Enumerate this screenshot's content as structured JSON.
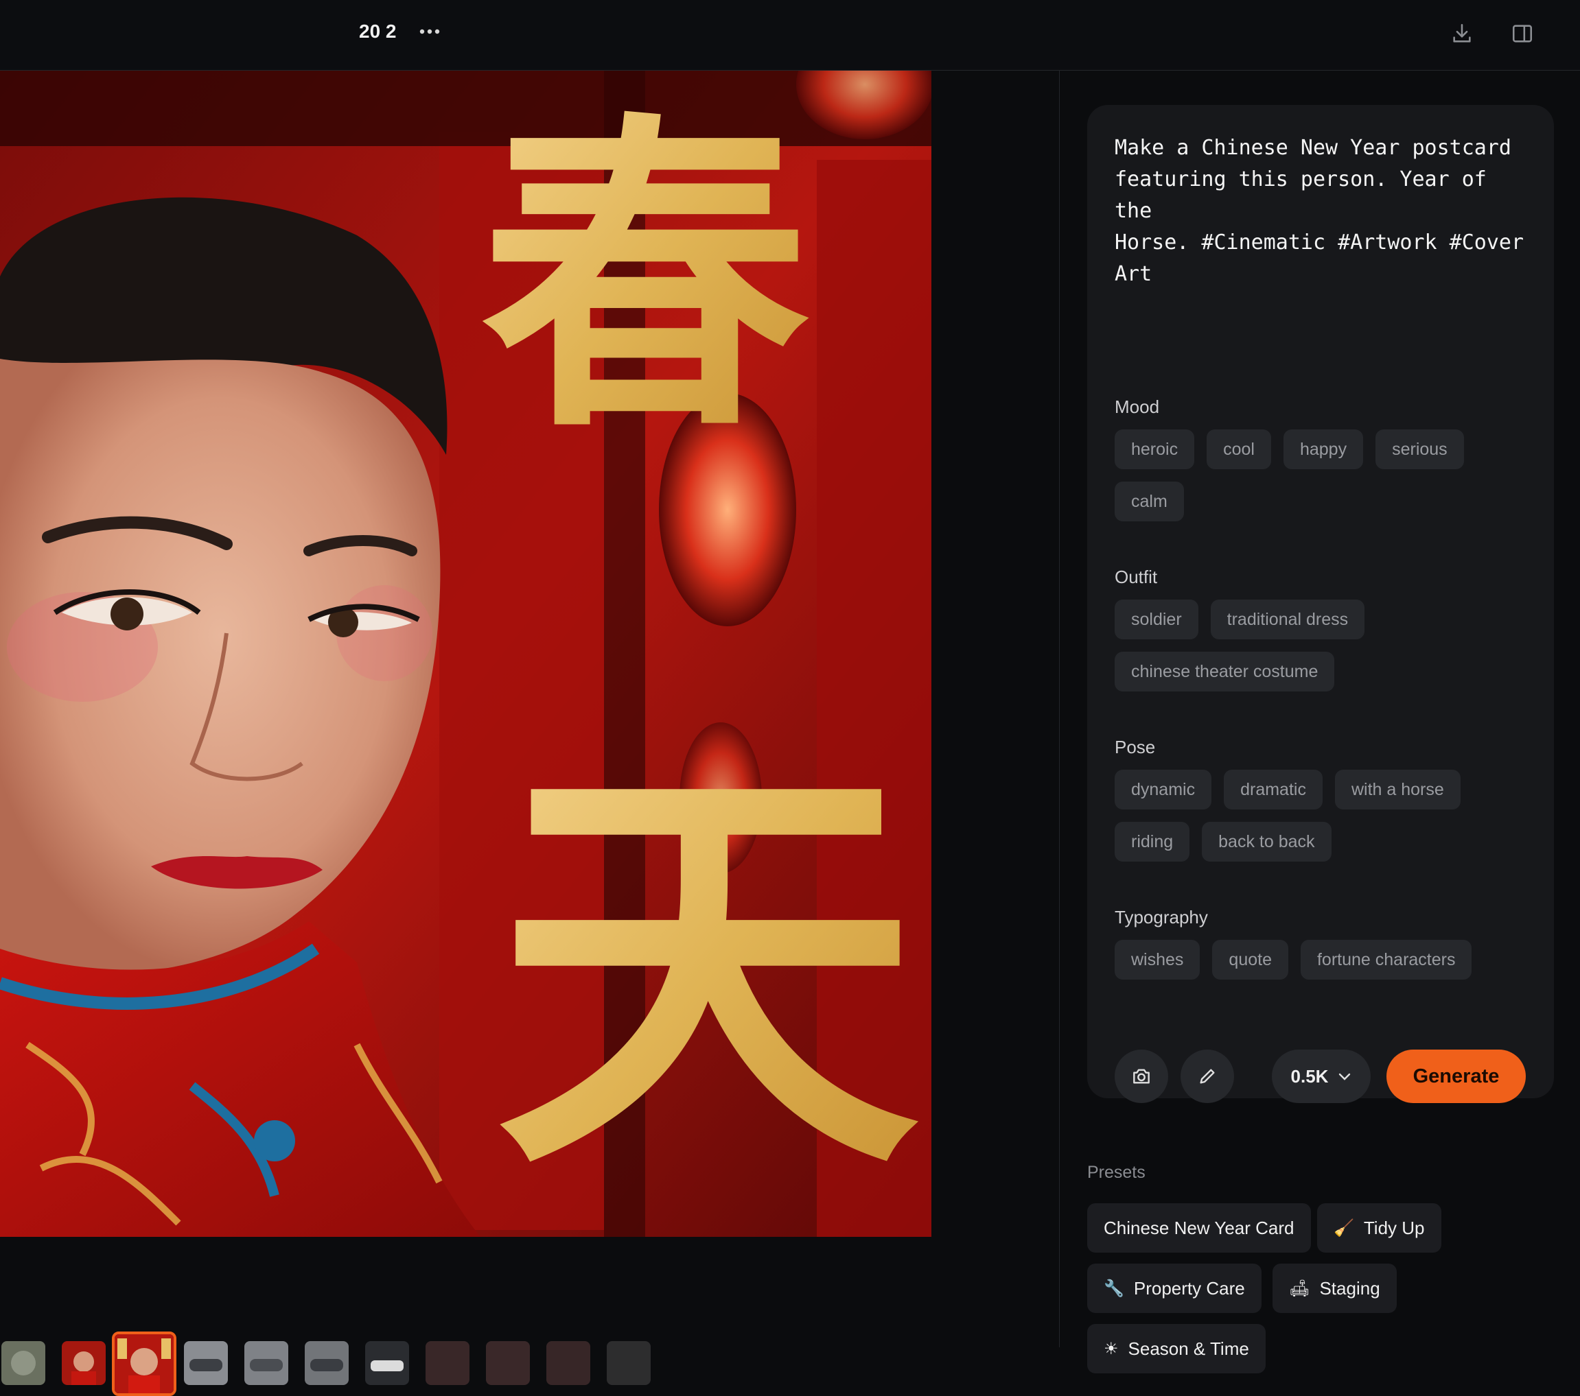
{
  "topbar": {
    "counter": "20 2",
    "more_icon": "more-horizontal-icon",
    "download_icon": "download-icon",
    "panel_icon": "sidebar-panel-icon"
  },
  "viewer": {
    "overlay_characters": [
      "春",
      "天"
    ],
    "filmstrip_count": 11,
    "selected_thumbnail_index": 2
  },
  "prompt": {
    "text": "Make a Chinese New Year postcard\nfeaturing this person. Year of the\nHorse. #Cinematic #Artwork #Cover\nArt"
  },
  "groups": [
    {
      "label": "Mood",
      "rows": [
        [
          "heroic",
          "cool",
          "happy",
          "serious"
        ],
        [
          "calm"
        ]
      ]
    },
    {
      "label": "Outfit",
      "rows": [
        [
          "soldier",
          "traditional dress"
        ],
        [
          "chinese theater costume"
        ]
      ]
    },
    {
      "label": "Pose",
      "rows": [
        [
          "dynamic",
          "dramatic",
          "with a horse"
        ],
        [
          "riding",
          "back to back"
        ]
      ]
    },
    {
      "label": "Typography",
      "rows": [
        [
          "wishes",
          "quote",
          "fortune characters"
        ]
      ]
    }
  ],
  "actions": {
    "camera_icon": "camera-icon",
    "edit_icon": "pencil-icon",
    "resolution": "0.5K",
    "generate": "Generate"
  },
  "presets": {
    "label": "Presets",
    "items": [
      {
        "label": "Chinese New Year Card",
        "icon": ""
      },
      {
        "label": "Tidy Up",
        "icon": "broom-icon"
      },
      {
        "label": "Property Care",
        "icon": "wrench-icon"
      },
      {
        "label": "Staging",
        "icon": "sofa-icon"
      },
      {
        "label": "Season & Time",
        "icon": "sun-icon"
      }
    ]
  },
  "colors": {
    "accent": "#f0601a",
    "background": "#0b0c0e",
    "card": "#17181b",
    "chip": "#26282c"
  }
}
